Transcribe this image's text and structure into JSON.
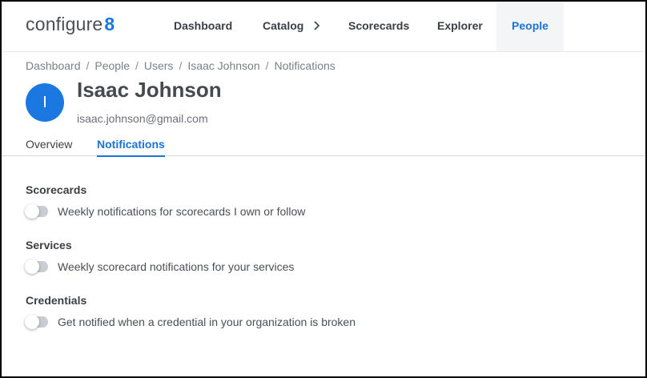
{
  "brand": {
    "logo_text": "configure",
    "logo_mark": "8",
    "accent_color": "#1a78e0"
  },
  "nav": {
    "items": [
      {
        "label": "Dashboard"
      },
      {
        "label": "Catalog"
      },
      {
        "label": "Scorecards"
      },
      {
        "label": "Explorer"
      },
      {
        "label": "People"
      }
    ],
    "active": "People"
  },
  "breadcrumb": [
    "Dashboard",
    "People",
    "Users",
    "Isaac Johnson",
    "Notifications"
  ],
  "user": {
    "initial": "I",
    "name": "Isaac Johnson",
    "email": "isaac.johnson@gmail.com"
  },
  "tabs": [
    {
      "label": "Overview",
      "active": false
    },
    {
      "label": "Notifications",
      "active": true
    }
  ],
  "sections": [
    {
      "title": "Scorecards",
      "setting": {
        "label": "Weekly notifications for scorecards I own or follow",
        "enabled": false
      }
    },
    {
      "title": "Services",
      "setting": {
        "label": "Weekly scorecard notifications for your services",
        "enabled": false
      }
    },
    {
      "title": "Credentials",
      "setting": {
        "label": "Get notified when a credential in your organization is broken",
        "enabled": false
      }
    }
  ]
}
